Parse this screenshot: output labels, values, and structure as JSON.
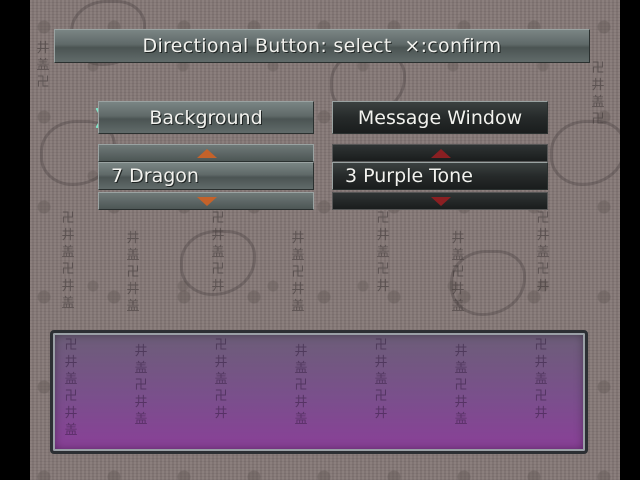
{
  "instruction_bar": {
    "text": "Directional Button: select  ×:confirm"
  },
  "background_option": {
    "label": "Background",
    "value": "7 Dragon",
    "up_arrow_icon": "triangle-up",
    "down_arrow_icon": "triangle-down"
  },
  "message_window_option": {
    "label": "Message Window",
    "value": "3 Purple Tone",
    "up_arrow_icon": "triangle-up",
    "down_arrow_icon": "triangle-down"
  },
  "cursor": {
    "icon": "pointer-arrow-icon",
    "selected": "Background",
    "color": "#7fe6c8"
  },
  "colors": {
    "background_tone": "#867a78",
    "active_arrow": "#c4622a",
    "inactive_arrow": "#8a1f22",
    "message_window_tone": "#7a4f8c"
  }
}
